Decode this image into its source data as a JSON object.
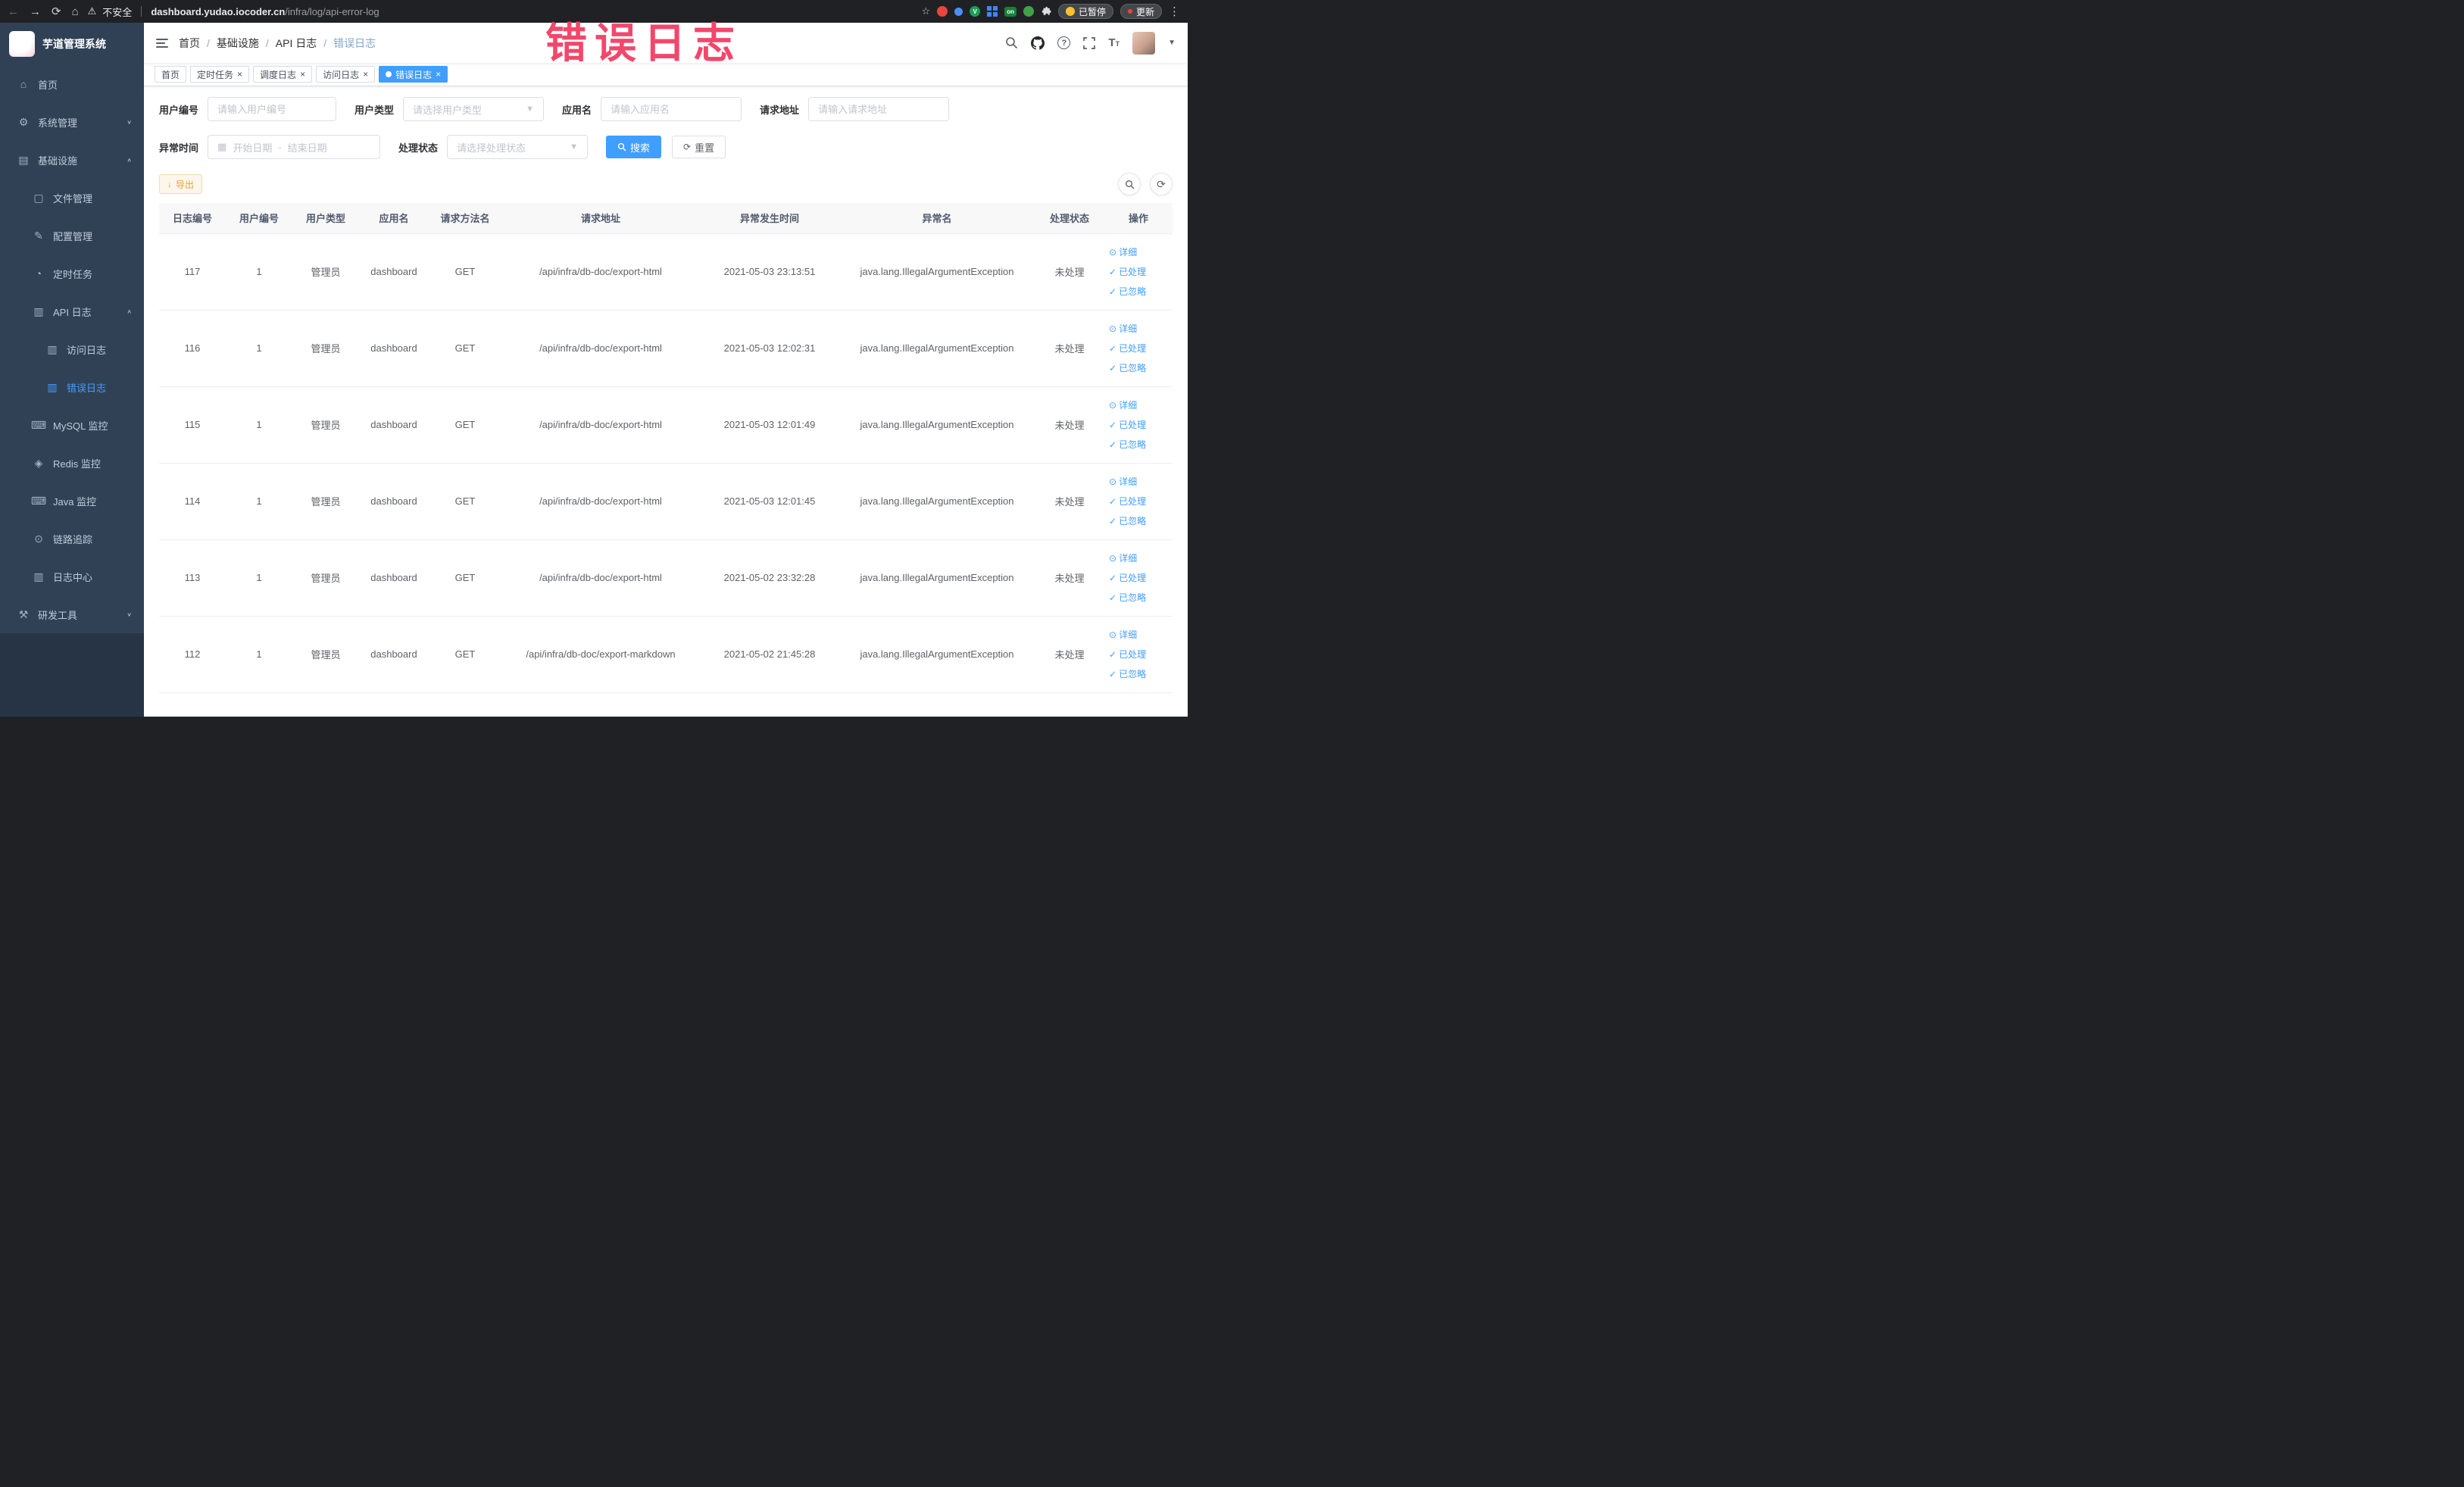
{
  "colors": {
    "accent": "#409eff",
    "sidebar_bg": "#304156",
    "warning": "#e6a23c"
  },
  "annotation": {
    "text": "错误日志",
    "color": "#f2476b"
  },
  "browser": {
    "security_label": "不安全",
    "url_domain": "dashboard.yudao.iocoder.cn",
    "url_path": "/infra/log/api-error-log",
    "extension_on_badge": "on",
    "extension_v_badge": "V",
    "paused_badge": "已暂停",
    "update_button": "更新"
  },
  "sidebar": {
    "logo_title": "芋道管理系统",
    "items": [
      {
        "key": "home",
        "label": "首页",
        "icon": "home",
        "level": 0
      },
      {
        "key": "system",
        "label": "系统管理",
        "icon": "gear",
        "level": 0,
        "chevron": "down"
      },
      {
        "key": "infra",
        "label": "基础设施",
        "icon": "grid",
        "level": 0,
        "chevron": "up"
      },
      {
        "key": "file",
        "label": "文件管理",
        "icon": "file",
        "level": 1
      },
      {
        "key": "config",
        "label": "配置管理",
        "icon": "edit",
        "level": 1
      },
      {
        "key": "job",
        "label": "定时任务",
        "icon": "clock",
        "level": 1
      },
      {
        "key": "api-log",
        "label": "API 日志",
        "icon": "doc",
        "level": 1,
        "chevron": "up"
      },
      {
        "key": "access-log",
        "label": "访问日志",
        "icon": "doc",
        "level": 2
      },
      {
        "key": "error-log",
        "label": "错误日志",
        "icon": "doc",
        "level": 2,
        "active": true
      },
      {
        "key": "mysql",
        "label": "MySQL 监控",
        "icon": "monitor",
        "level": 1
      },
      {
        "key": "redis",
        "label": "Redis 监控",
        "icon": "db",
        "level": 1
      },
      {
        "key": "java",
        "label": "Java 监控",
        "icon": "monitor",
        "level": 1
      },
      {
        "key": "trace",
        "label": "链路追踪",
        "icon": "eye",
        "level": 1
      },
      {
        "key": "log-center",
        "label": "日志中心",
        "icon": "doc",
        "level": 1
      },
      {
        "key": "devtools",
        "label": "研发工具",
        "icon": "tools",
        "level": 0,
        "chevron": "down"
      }
    ]
  },
  "header": {
    "breadcrumb": [
      "首页",
      "基础设施",
      "API 日志",
      "错误日志"
    ]
  },
  "tags": [
    {
      "label": "首页",
      "closable": false,
      "active": false
    },
    {
      "label": "定时任务",
      "closable": true,
      "active": false
    },
    {
      "label": "调度日志",
      "closable": true,
      "active": false
    },
    {
      "label": "访问日志",
      "closable": true,
      "active": false
    },
    {
      "label": "错误日志",
      "closable": true,
      "active": true
    }
  ],
  "filters": {
    "user_id": {
      "label": "用户编号",
      "placeholder": "请输入用户编号"
    },
    "user_type": {
      "label": "用户类型",
      "placeholder": "请选择用户类型"
    },
    "app_name": {
      "label": "应用名",
      "placeholder": "请输入应用名"
    },
    "request_url": {
      "label": "请求地址",
      "placeholder": "请输入请求地址"
    },
    "exception_time": {
      "label": "异常时间",
      "start_placeholder": "开始日期",
      "separator": "-",
      "end_placeholder": "结束日期"
    },
    "status": {
      "label": "处理状态",
      "placeholder": "请选择处理状态"
    },
    "search_label": "搜索",
    "reset_label": "重置"
  },
  "toolbar": {
    "export_label": "导出"
  },
  "table": {
    "columns": [
      {
        "key": "id",
        "label": "日志编号"
      },
      {
        "key": "user_id",
        "label": "用户编号"
      },
      {
        "key": "user_type",
        "label": "用户类型"
      },
      {
        "key": "app_name",
        "label": "应用名"
      },
      {
        "key": "method",
        "label": "请求方法名"
      },
      {
        "key": "request_url",
        "label": "请求地址"
      },
      {
        "key": "time",
        "label": "异常发生时间"
      },
      {
        "key": "exception",
        "label": "异常名"
      },
      {
        "key": "status",
        "label": "处理状态"
      },
      {
        "key": "actions",
        "label": "操作"
      }
    ],
    "actions": [
      {
        "key": "detail",
        "label": "详细"
      },
      {
        "key": "processed",
        "label": "已处理"
      },
      {
        "key": "ignored",
        "label": "已忽略"
      }
    ],
    "rows": [
      {
        "id": "117",
        "user_id": "1",
        "user_type": "管理员",
        "app_name": "dashboard",
        "method": "GET",
        "request_url": "/api/infra/db-doc/export-html",
        "time": "2021-05-03 23:13:51",
        "exception": "java.lang.IllegalArgumentException",
        "status": "未处理"
      },
      {
        "id": "116",
        "user_id": "1",
        "user_type": "管理员",
        "app_name": "dashboard",
        "method": "GET",
        "request_url": "/api/infra/db-doc/export-html",
        "time": "2021-05-03 12:02:31",
        "exception": "java.lang.IllegalArgumentException",
        "status": "未处理"
      },
      {
        "id": "115",
        "user_id": "1",
        "user_type": "管理员",
        "app_name": "dashboard",
        "method": "GET",
        "request_url": "/api/infra/db-doc/export-html",
        "time": "2021-05-03 12:01:49",
        "exception": "java.lang.IllegalArgumentException",
        "status": "未处理"
      },
      {
        "id": "114",
        "user_id": "1",
        "user_type": "管理员",
        "app_name": "dashboard",
        "method": "GET",
        "request_url": "/api/infra/db-doc/export-html",
        "time": "2021-05-03 12:01:45",
        "exception": "java.lang.IllegalArgumentException",
        "status": "未处理"
      },
      {
        "id": "113",
        "user_id": "1",
        "user_type": "管理员",
        "app_name": "dashboard",
        "method": "GET",
        "request_url": "/api/infra/db-doc/export-html",
        "time": "2021-05-02 23:32:28",
        "exception": "java.lang.IllegalArgumentException",
        "status": "未处理"
      },
      {
        "id": "112",
        "user_id": "1",
        "user_type": "管理员",
        "app_name": "dashboard",
        "method": "GET",
        "request_url": "/api/infra/db-doc/export-markdown",
        "time": "2021-05-02 21:45:28",
        "exception": "java.lang.IllegalArgumentException",
        "status": "未处理"
      }
    ]
  }
}
